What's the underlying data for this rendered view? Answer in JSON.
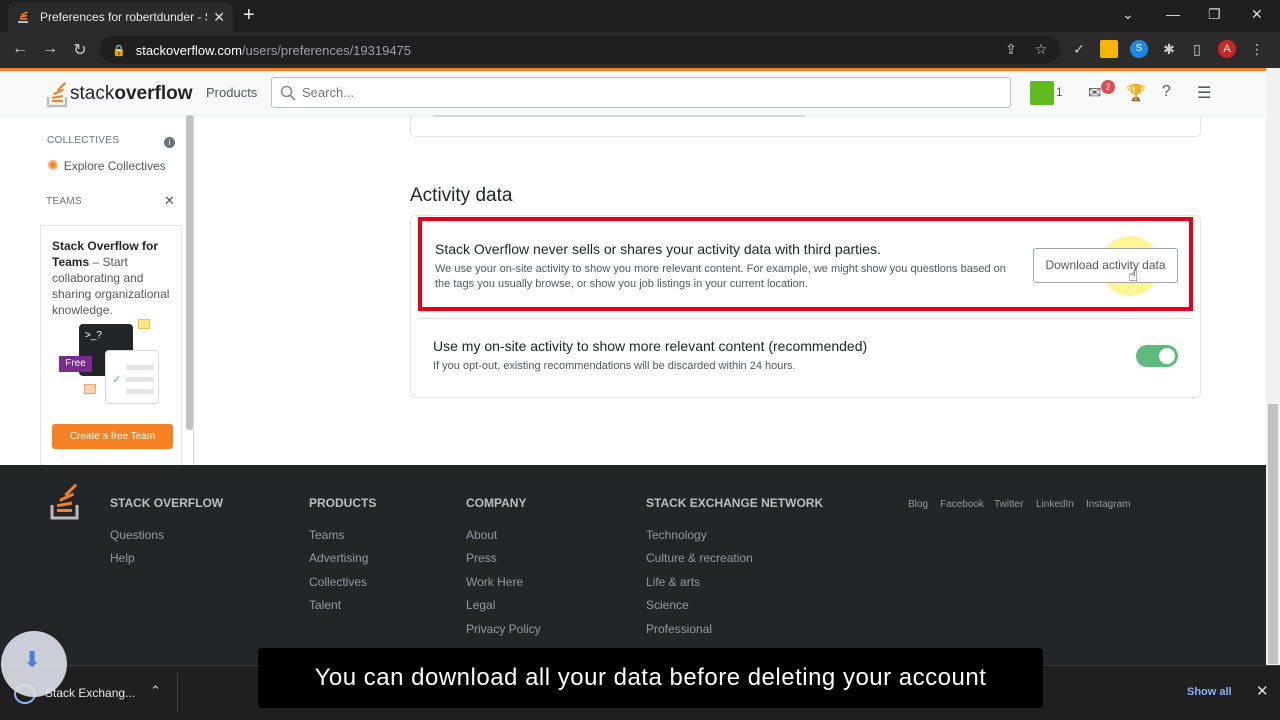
{
  "browser": {
    "tab_title": "Preferences for robertdunder - St",
    "tab_close": "✕",
    "new_tab": "+",
    "url_host": "stackoverflow.com",
    "url_path": "/users/preferences/19319475",
    "profile_initial": "A"
  },
  "so_header": {
    "logo_light": "stack",
    "logo_bold": "overflow",
    "products": "Products",
    "search_placeholder": "Search...",
    "reputation": "1",
    "inbox_count": "2"
  },
  "sidebar": {
    "collectives_head": "COLLECTIVES",
    "explore_collectives": "Explore Collectives",
    "teams_head": "TEAMS",
    "teams_title": "Stack Overflow for Teams",
    "teams_dash": " – Start collaborating and sharing organizational knowledge.",
    "free_badge": "Free",
    "terminal": ">_?",
    "create_team": "Create a free Team"
  },
  "activity": {
    "section_title": "Activity data",
    "sells_title": "Stack Overflow never sells or shares your activity data with third parties.",
    "sells_desc": "We use your on-site activity to show you more relevant content. For example, we might show you questions based on the tags you usually browse, or show you job listings in your current location.",
    "download_button": "Download activity data",
    "use_title": "Use my on-site activity to show more relevant content (recommended)",
    "use_desc": "If you opt-out, existing recommendations will be discarded within 24 hours.",
    "toggle_on": 1
  },
  "footer": {
    "col1_head": "STACK OVERFLOW",
    "col1_links": [
      "Questions",
      "Help"
    ],
    "col2_head": "PRODUCTS",
    "col2_links": [
      "Teams",
      "Advertising",
      "Collectives",
      "Talent"
    ],
    "col3_head": "COMPANY",
    "col3_links": [
      "About",
      "Press",
      "Work Here",
      "Legal",
      "Privacy Policy"
    ],
    "col4_head": "STACK EXCHANGE NETWORK",
    "col4_links": [
      "Technology",
      "Culture & recreation",
      "Life & arts",
      "Science",
      "Professional"
    ],
    "social": [
      "Blog",
      "Facebook",
      "Twitter",
      "LinkedIn",
      "Instagram"
    ]
  },
  "download_bar": {
    "item_label": "Stack Exchang...",
    "show_all": "Show all",
    "close": "✕"
  },
  "caption": "You can download all your data before deleting your account",
  "colors": {
    "so_orange": "#f48225",
    "highlight_red": "#e2001a",
    "toggle_green": "#5eba7d",
    "footer_bg": "#232629"
  }
}
